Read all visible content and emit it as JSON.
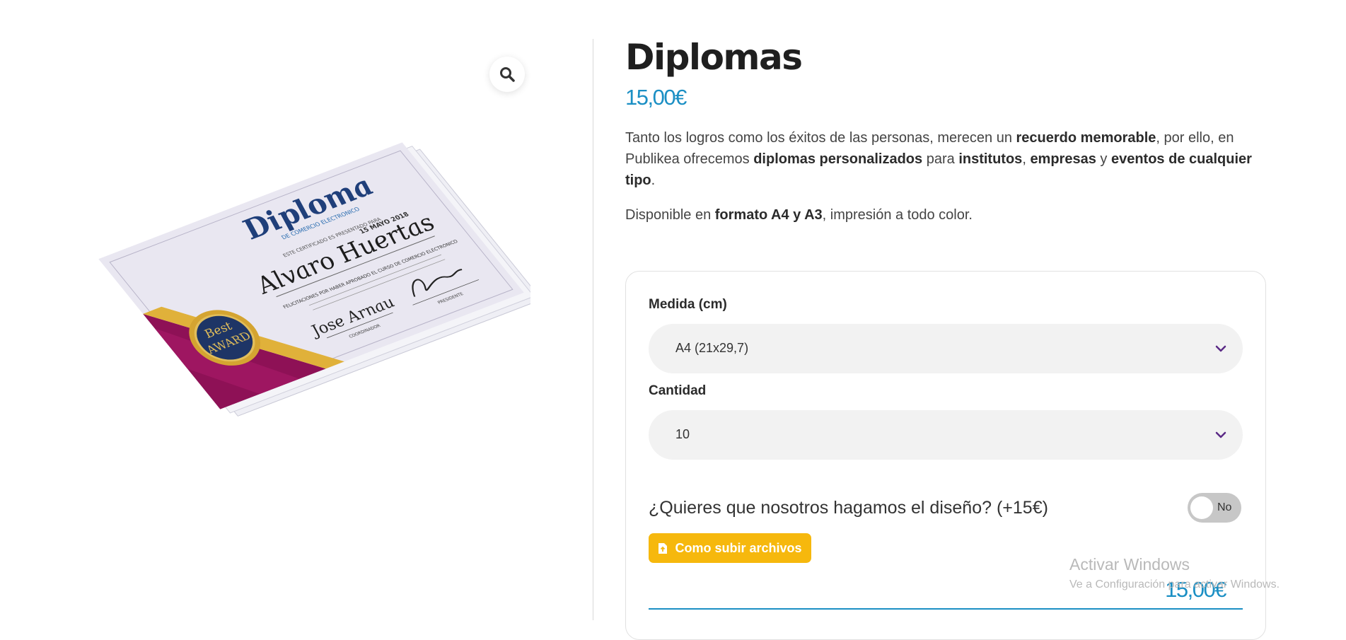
{
  "product": {
    "title": "Diplomas",
    "price": "15,00€"
  },
  "description": {
    "p1_a": "Tanto los logros como los éxitos de las personas, merecen un ",
    "p1_b": "recuerdo memorable",
    "p1_c": ", por ello, en Publikea ofrecemos ",
    "p1_d": "diplomas personalizados",
    "p1_e": " para ",
    "p1_f": "institutos",
    "p1_g": ", ",
    "p1_h": "empresas",
    "p1_i": " y ",
    "p1_j": "eventos de cualquier tipo",
    "p1_k": ".",
    "p2_a": "Disponible en ",
    "p2_b": "formato A4 y A3",
    "p2_c": ", impresión a todo color."
  },
  "options": {
    "size_label": "Medida (cm)",
    "size_value": "A4 (21x29,7)",
    "qty_label": "Cantidad",
    "qty_value": "10",
    "design_question": "¿Quieres que nosotros hagamos el diseño? (+15€)",
    "design_toggle": "No",
    "upload_button": "Como subir archivos",
    "total_price": "15,00€"
  },
  "diploma_image": {
    "heading": "Diploma",
    "subheading": "DE COMERCIO ELECTRONICO",
    "certify_line": "ESTE CERTIFICADO ES PRESENTADO PARA",
    "recipient": "Alvaro Huertas",
    "date": "15 MAYO 2018",
    "body": "FELICITACIONES POR HABER APROBADO EL CURSO DE COMERCIO ELECTRONICO",
    "signer1": "Jose Arnau",
    "signer1_role": "COORDINADOR",
    "signer2_role": "PRESIDENTE",
    "seal_top": "Best",
    "seal_main": "AWARD"
  },
  "watermark": {
    "title": "Activar Windows",
    "subtitle": "Ve a Configuración para activar Windows."
  },
  "colors": {
    "accent": "#1b8fc4",
    "button": "#f6b80d",
    "diploma_magenta": "#8e1156",
    "select_bg": "#f2f2f2",
    "chevron": "#5b2a86"
  }
}
